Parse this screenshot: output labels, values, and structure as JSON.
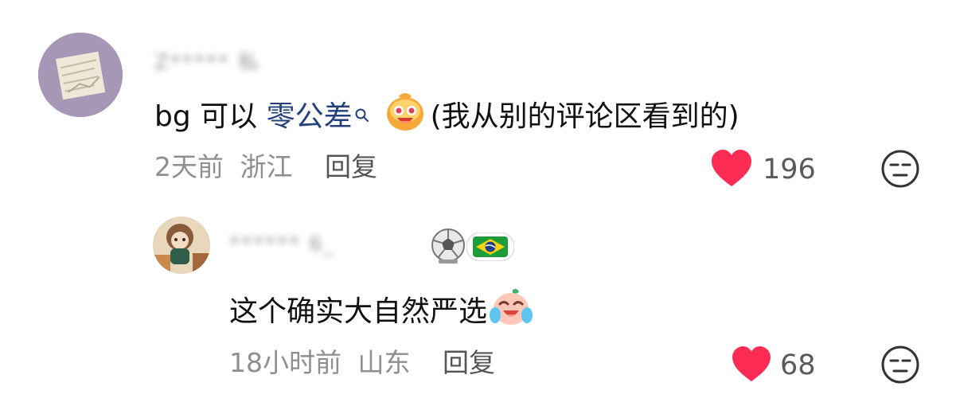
{
  "comments": [
    {
      "user_name": "Z***** 私",
      "content_prefix": "bg 可以 ",
      "content_link": "零公差",
      "content_suffix": "(我从别的评论区看到的)",
      "time": "2天前",
      "location": "浙江",
      "reply_label": "回复",
      "likes": "196"
    },
    {
      "user_name": "****** 6_",
      "content": "这个确实大自然严选",
      "time": "18小时前",
      "location": "山东",
      "reply_label": "回复",
      "likes": "68"
    }
  ],
  "colors": {
    "heart": "#fe2c55",
    "link": "#23407a",
    "meta": "#8f8f8f"
  },
  "icons": [
    "heart-icon",
    "unamused-face-icon",
    "search-icon",
    "brazil-flag-icon",
    "soccer-ball-icon"
  ]
}
